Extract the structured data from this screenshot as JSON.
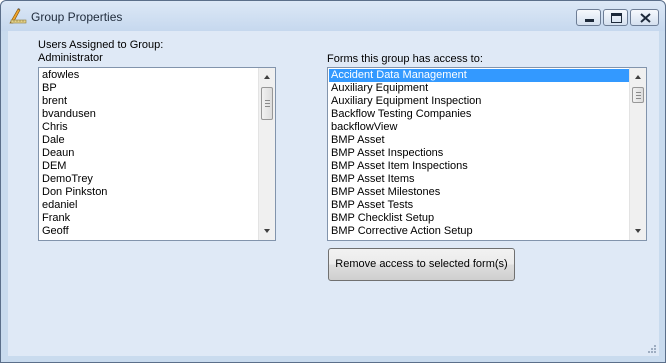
{
  "window": {
    "title": "Group Properties",
    "icon": "pencil-ruler-icon",
    "buttons": {
      "minimize": "minimize-icon",
      "maximize": "maximize-icon",
      "close": "close-icon"
    }
  },
  "users": {
    "heading": "Users Assigned to Group:",
    "group_name": "Administrator",
    "items": [
      "afowles",
      "BP",
      "brent",
      "bvandusen",
      "Chris",
      "Dale",
      "Deaun",
      "DEM",
      "DemoTrey",
      "Don Pinkston",
      "edaniel",
      "Frank",
      "Geoff"
    ]
  },
  "forms": {
    "heading": "Forms this group has access to:",
    "selected_index": 0,
    "items": [
      "Accident Data Management",
      "Auxiliary Equipment",
      "Auxiliary Equipment Inspection",
      "Backflow Testing Companies",
      "backflowView",
      "BMP Asset",
      "BMP Asset Inspections",
      "BMP Asset Item Inspections",
      "BMP Asset Items",
      "BMP Asset Milestones",
      "BMP Asset Tests",
      "BMP Checklist Setup",
      "BMP Corrective Action Setup"
    ]
  },
  "actions": {
    "remove_label": "Remove access to selected form(s)"
  },
  "colors": {
    "selection": "#3399ff",
    "client_background": "#dfe9f6",
    "frame_background": "#c9dbee"
  }
}
